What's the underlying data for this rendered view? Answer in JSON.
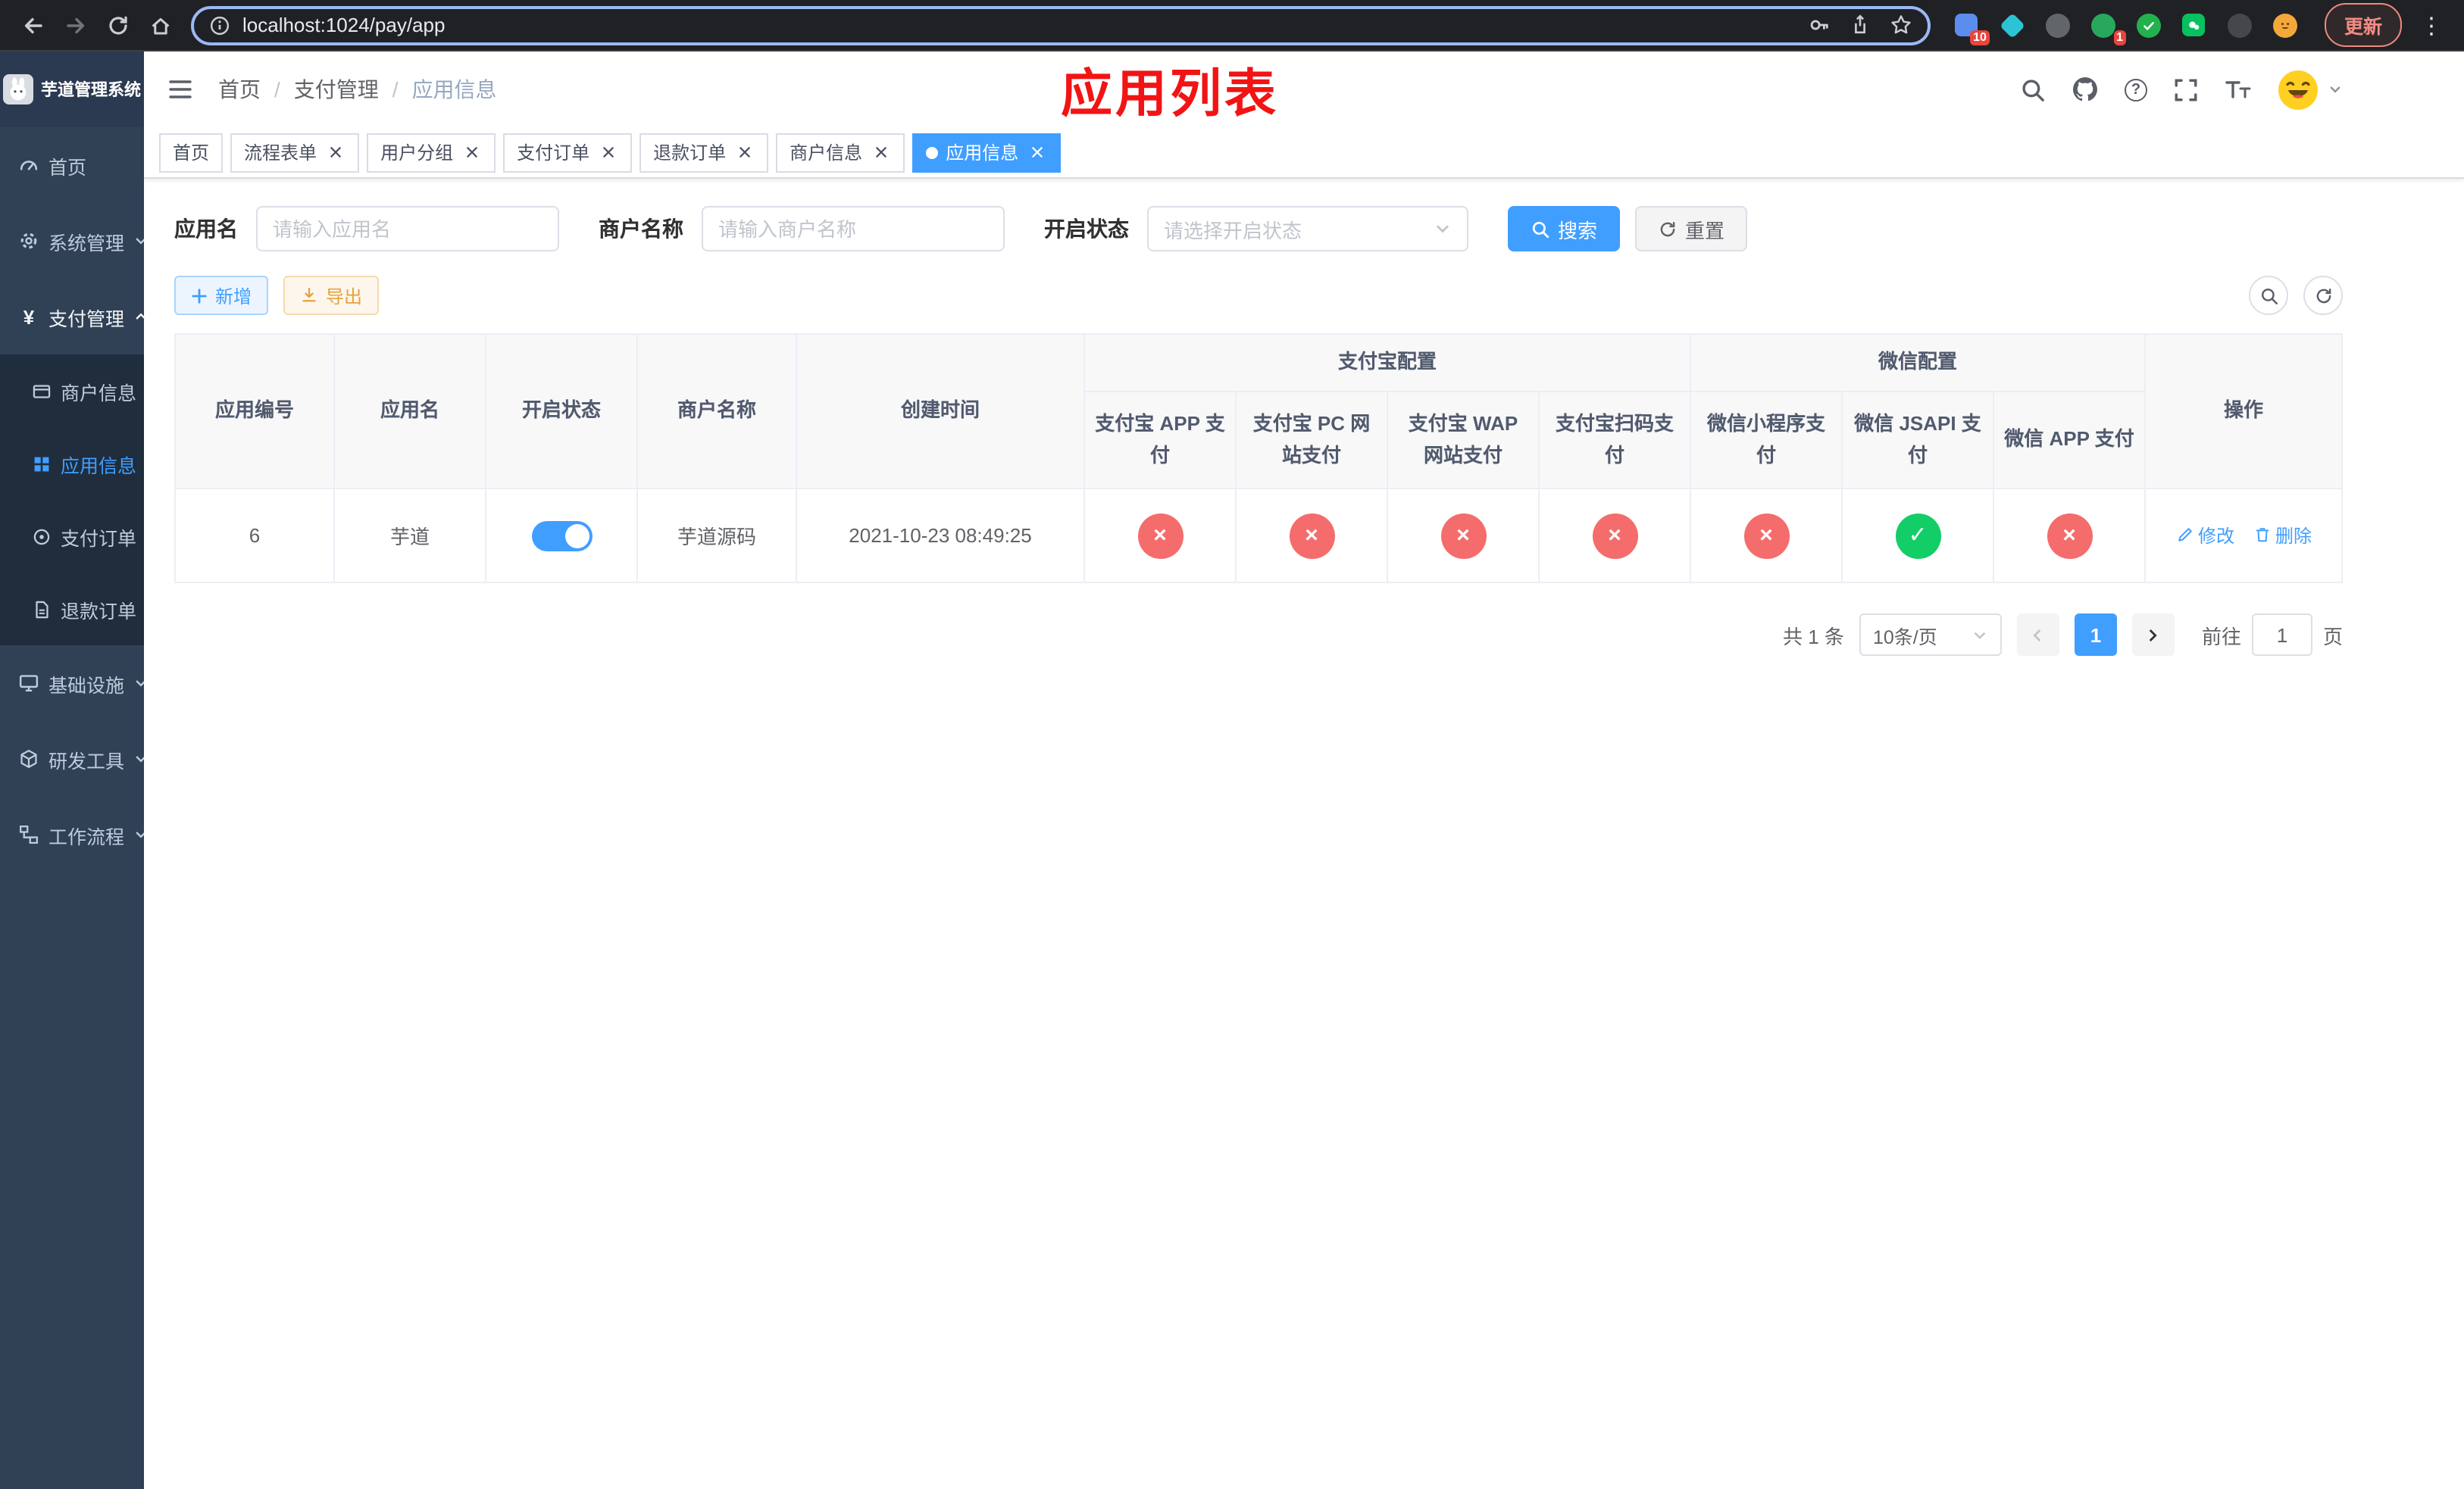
{
  "glyphs": {
    "cross": "×",
    "check": "✓",
    "yen": "¥",
    "question": "?",
    "dots": "⋮"
  },
  "browser": {
    "url": "localhost:1024/pay/app",
    "update_button": "更新",
    "extensions_badge": "10",
    "profile_badge": "1"
  },
  "sidebar": {
    "title": "芋道管理系统",
    "items": {
      "home": "首页",
      "system": "系统管理",
      "payment": "支付管理",
      "merchant_info": "商户信息",
      "app_info": "应用信息",
      "pay_order": "支付订单",
      "refund_order": "退款订单",
      "infra": "基础设施",
      "dev_tools": "研发工具",
      "workflow": "工作流程"
    }
  },
  "navbar": {
    "breadcrumb_home": "首页",
    "breadcrumb_payment": "支付管理",
    "breadcrumb_current": "应用信息",
    "separator": "/",
    "annotation": "应用列表"
  },
  "tabs": {
    "home": "首页",
    "flow_form": "流程表单",
    "user_group": "用户分组",
    "pay_order": "支付订单",
    "refund_order": "退款订单",
    "merchant_info": "商户信息",
    "app_info": "应用信息"
  },
  "filter": {
    "app_name_label": "应用名",
    "app_name_placeholder": "请输入应用名",
    "merchant_label": "商户名称",
    "merchant_placeholder": "请输入商户名称",
    "status_label": "开启状态",
    "status_placeholder": "请选择开启状态",
    "search": "搜索",
    "reset": "重置"
  },
  "toolbar": {
    "add": "新增",
    "export": "导出"
  },
  "table": {
    "groups": {
      "alipay": "支付宝配置",
      "wechat": "微信配置"
    },
    "columns": {
      "id": "应用编号",
      "name": "应用名",
      "status": "开启状态",
      "merchant": "商户名称",
      "created": "创建时间",
      "alipay_app": "支付宝 APP 支付",
      "alipay_pc": "支付宝 PC 网站支付",
      "alipay_wap": "支付宝 WAP 网站支付",
      "alipay_scan": "支付宝扫码支付",
      "wechat_mini": "微信小程序支付",
      "wechat_jsapi": "微信 JSAPI 支付",
      "wechat_app": "微信 APP 支付",
      "ops": "操作"
    },
    "row": {
      "id": "6",
      "name": "芋道",
      "enabled": true,
      "merchant": "芋道源码",
      "created": "2021-10-23 08:49:25",
      "alipay_app": false,
      "alipay_pc": false,
      "alipay_wap": false,
      "alipay_scan": false,
      "wechat_mini": false,
      "wechat_jsapi": true,
      "wechat_app": false
    },
    "ops": {
      "edit": "修改",
      "delete": "删除"
    }
  },
  "pagination": {
    "total": "共 1 条",
    "page_size": "10条/页",
    "page": "1",
    "goto_label": "前往",
    "goto_value": "1",
    "unit_label": "页"
  },
  "colors": {
    "primary": "#409eff",
    "danger": "#f56c6c",
    "success": "#13ce66",
    "sidebar_bg": "#304156",
    "annotation_red": "#f21414"
  }
}
